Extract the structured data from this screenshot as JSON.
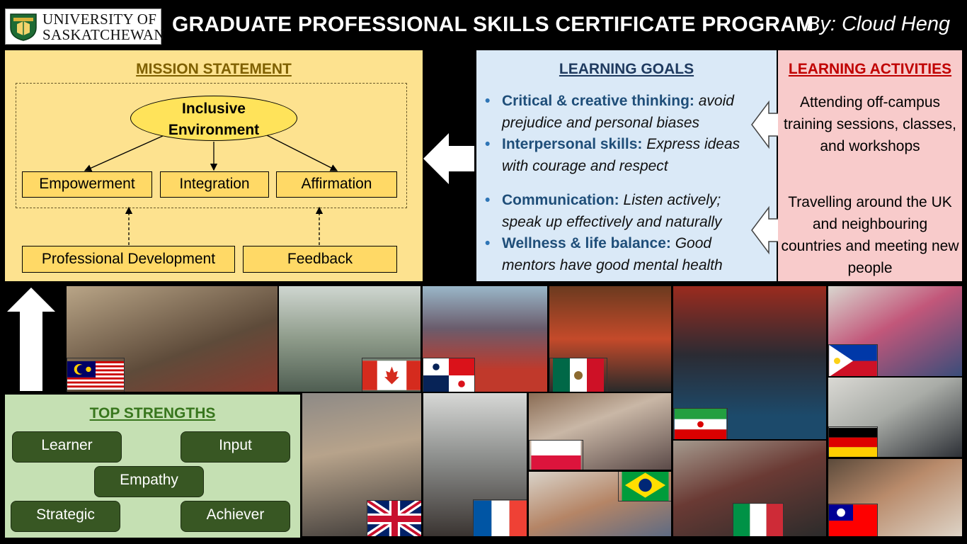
{
  "header": {
    "logo_text_line1": "UNIVERSITY OF",
    "logo_text_line2": "SASKATCHEWAN",
    "title": "GRADUATE PROFESSIONAL SKILLS CERTIFICATE PROGRAM",
    "byline": "By: Cloud Heng"
  },
  "mission": {
    "title": "MISSION STATEMENT",
    "center_line1": "Inclusive",
    "center_line2": "Environment",
    "outcomes": [
      "Empowerment",
      "Integration",
      "Affirmation"
    ],
    "inputs": [
      "Professional Development",
      "Feedback"
    ]
  },
  "goals": {
    "title": "LEARNING GOALS",
    "items": [
      {
        "term": "Critical & creative thinking:",
        "desc": "avoid prejudice and personal biases"
      },
      {
        "term": "Interpersonal skills:",
        "desc": "Express ideas with courage and respect"
      },
      {
        "term": "Communication:",
        "desc": "Listen actively; speak up effectively and naturally"
      },
      {
        "term": "Wellness & life balance:",
        "desc": "Good mentors have good mental health"
      }
    ]
  },
  "activities": {
    "title": "LEARNING ACTIVITIES",
    "items": [
      "Attending off-campus training sessions, classes, and workshops",
      "Travelling around the UK and neighbouring countries and meeting new people"
    ]
  },
  "strengths": {
    "title": "TOP STRENGTHS",
    "items": [
      "Learner",
      "Input",
      "Empathy",
      "Strategic",
      "Achiever"
    ]
  },
  "colors": {
    "mission_bg": "#fde28f",
    "goals_bg": "#dae9f7",
    "activities_bg": "#f8cbcb",
    "strengths_bg": "#c5e0b3",
    "strength_button": "#385723"
  },
  "photos": [
    {
      "flag": "malaysia-flag"
    },
    {
      "flag": "canada-flag"
    },
    {
      "flag": "panama-flag"
    },
    {
      "flag": "mexico-flag"
    },
    {
      "flag": "iran-flag"
    },
    {
      "flag": "philippines-flag"
    },
    {
      "flag": "germany-flag"
    },
    {
      "flag": "uk-flag"
    },
    {
      "flag": "france-flag"
    },
    {
      "flag": "poland-flag"
    },
    {
      "flag": "brazil-flag"
    },
    {
      "flag": "italy-flag"
    },
    {
      "flag": "taiwan-flag"
    }
  ]
}
